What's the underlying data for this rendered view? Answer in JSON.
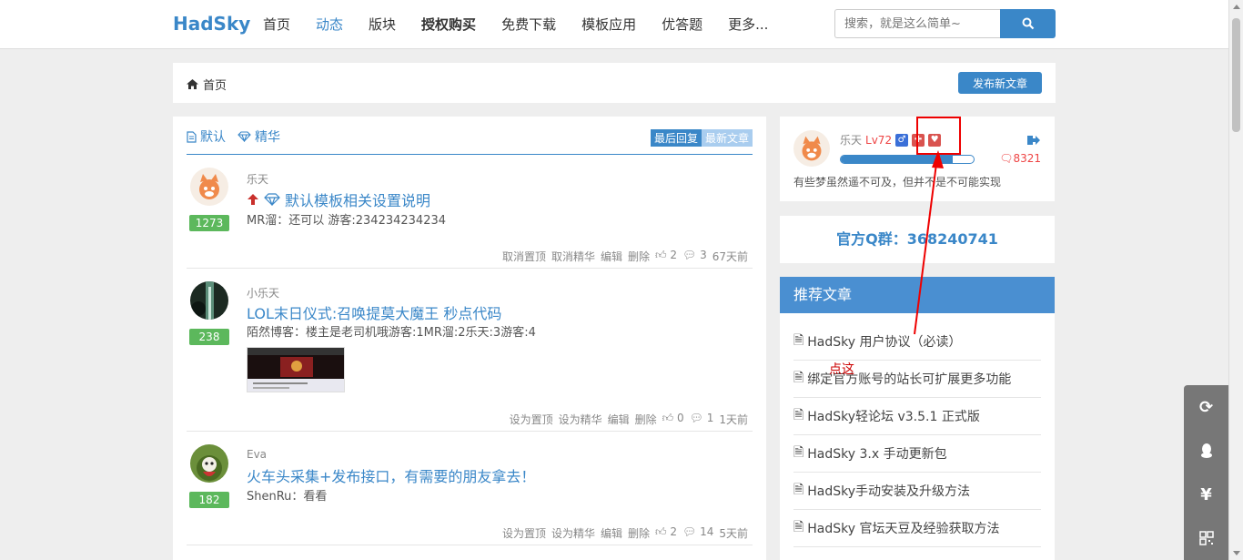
{
  "header": {
    "logo": "HadSky",
    "nav": [
      {
        "label": "首页",
        "active": false,
        "bold": false
      },
      {
        "label": "动态",
        "active": true,
        "bold": false
      },
      {
        "label": "版块",
        "active": false,
        "bold": false
      },
      {
        "label": "授权购买",
        "active": false,
        "bold": true
      },
      {
        "label": "免费下载",
        "active": false,
        "bold": false
      },
      {
        "label": "模板应用",
        "active": false,
        "bold": false
      },
      {
        "label": "优答题",
        "active": false,
        "bold": false
      },
      {
        "label": "更多...",
        "active": false,
        "bold": false
      }
    ],
    "search_placeholder": "搜索，就是这么简单~"
  },
  "breadcrumb": {
    "home": "首页",
    "post_button": "发布新文章"
  },
  "list": {
    "tab_default": "默认",
    "tab_featured": "精华",
    "sort_last_reply": "最后回复",
    "sort_newest": "最新文章",
    "posts": [
      {
        "author": "乐天",
        "title": "默认模板相关设置说明",
        "summary": "MR溜：还可以 游客:234234234234",
        "count": "1273",
        "action1": "取消置顶",
        "action2": "取消精华",
        "edit": "编辑",
        "delete": "删除",
        "likes": "2",
        "comments": "3",
        "time": "67天前"
      },
      {
        "author": "小乐天",
        "title": "LOL末日仪式:召唤提莫大魔王 秒点代码",
        "summary": "陌然博客：楼主是老司机哦游客:1MR溜:2乐天:3游客:4",
        "count": "238",
        "action1": "设为置顶",
        "action2": "设为精华",
        "edit": "编辑",
        "delete": "删除",
        "likes": "0",
        "comments": "1",
        "time": "1天前"
      },
      {
        "author": "Eva",
        "title": "火车头采集+发布接口，有需要的朋友拿去！",
        "summary": "ShenRu：看看",
        "count": "182",
        "action1": "设为置顶",
        "action2": "设为精华",
        "edit": "编辑",
        "delete": "删除",
        "likes": "2",
        "comments": "14",
        "time": "5天前"
      }
    ]
  },
  "user": {
    "name": "乐天",
    "level": "Lv72",
    "messages": "8321",
    "signature": "有些梦虽然遥不可及，但并不是不可能实现",
    "exp_fraction": 0.84
  },
  "qq_group": "官方Q群：368240741",
  "recommend": {
    "title": "推荐文章",
    "items": [
      "HadSky 用户协议（必读）",
      "绑定官方账号的站长可扩展更多功能",
      "HadSky轻论坛 v3.5.1 正式版",
      "HadSky 3.x 手动更新包",
      "HadSky手动安装及升级方法",
      "HadSky 官坛天豆及经验获取方法"
    ]
  },
  "annotation": {
    "text": "点这"
  },
  "colors": {
    "accent": "#3a87c8",
    "count_badge": "#5cb85c",
    "annotation": "#e00000"
  }
}
